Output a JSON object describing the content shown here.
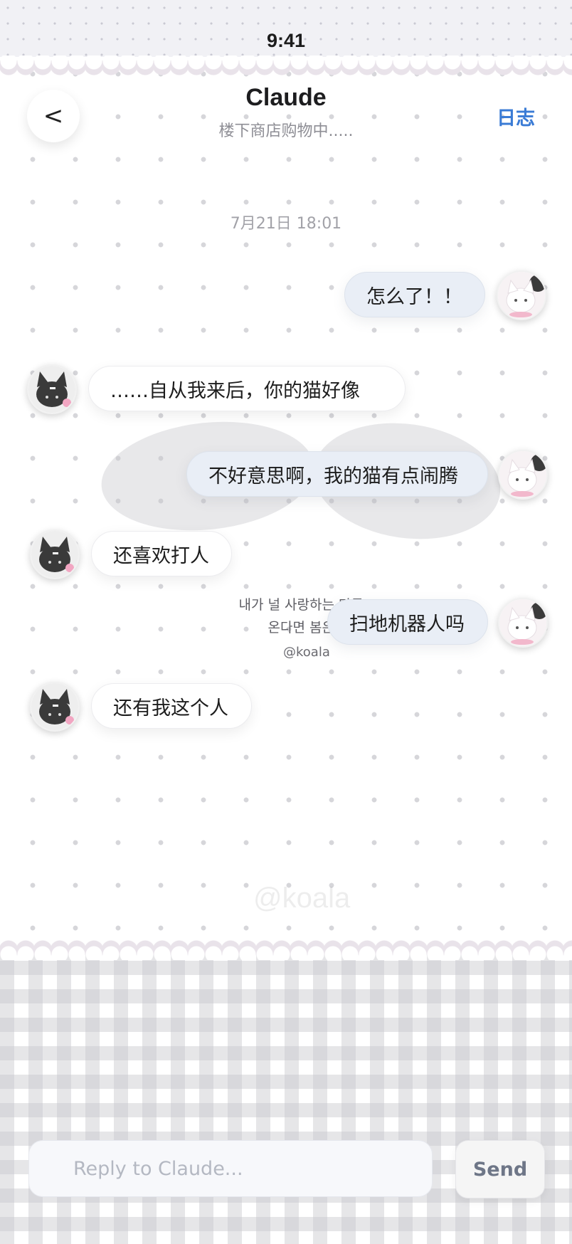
{
  "status_bar": {
    "time": "9:41"
  },
  "header": {
    "back_icon": "chevron-left",
    "title": "Claude",
    "subtitle": "楼下商店购物中.....",
    "log_label": "日志"
  },
  "timestamp": "7月21日 18:01",
  "messages": [
    {
      "side": "right",
      "avatar": "white-cat",
      "text": "怎么了！！"
    },
    {
      "side": "left",
      "avatar": "black-cat",
      "text": "……自从我来后，你的猫好像"
    },
    {
      "side": "right",
      "avatar": "white-cat",
      "text": "不好意思啊，我的猫有点闹腾"
    },
    {
      "side": "left",
      "avatar": "black-cat",
      "text": "还喜欢打人"
    },
    {
      "side": "right",
      "avatar": "white-cat",
      "text": "扫地机器人吗"
    },
    {
      "side": "left",
      "avatar": "black-cat",
      "text": "还有我这个人"
    }
  ],
  "watermark": {
    "line1": "내가 널 사랑하는 만큼 ㅎ",
    "line2": "온다면 봄은 오",
    "handle": "@koala",
    "large": "@koala"
  },
  "composer": {
    "placeholder": "Reply to Claude...",
    "send_label": "Send"
  },
  "colors": {
    "accent": "#3a7bd5",
    "bubble_right": "#e9eef6",
    "bubble_left": "#ffffff"
  }
}
